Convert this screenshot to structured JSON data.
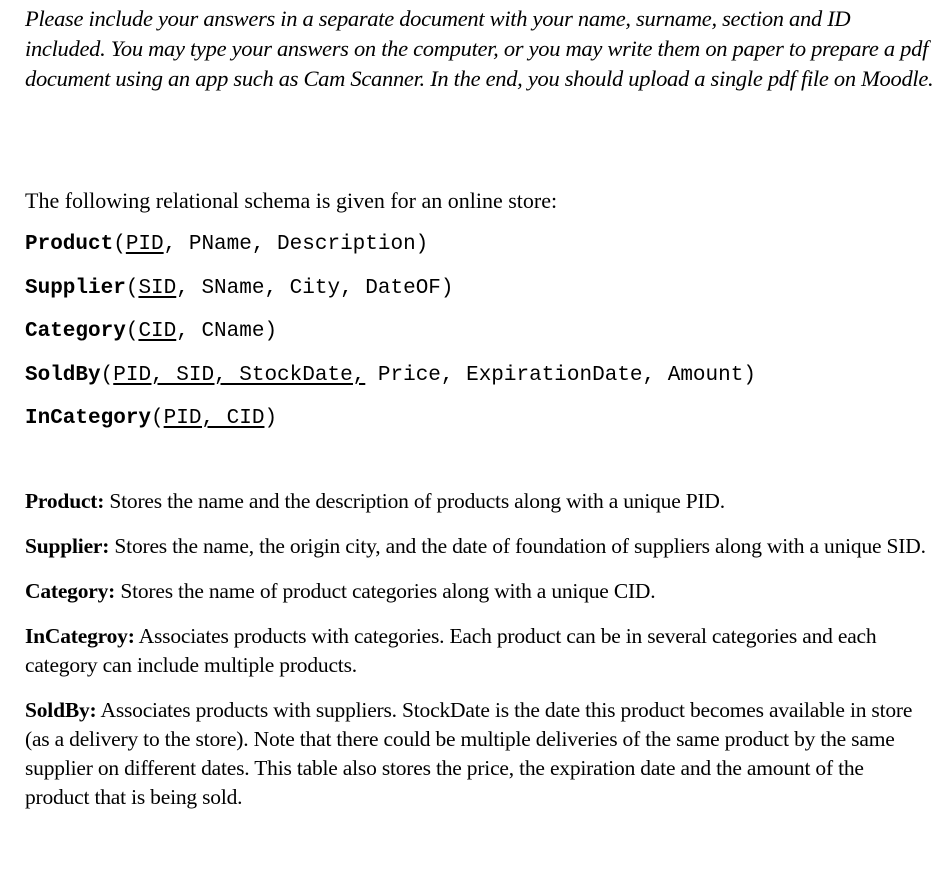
{
  "instructions": "Please include your answers in a separate document with your name, surname, section and ID included. You may type your answers on the computer, or you may write them on paper to prepare a pdf document using an app such as Cam Scanner. In the end, you should upload a single pdf file on Moodle.",
  "intro": "The following relational schema is given for an online store:",
  "schema": [
    {
      "table": "Product",
      "key_text": "PID",
      "rest_text": ", PName, Description)"
    },
    {
      "table": "Supplier",
      "key_text": "SID",
      "rest_text": ", SName, City, DateOF)"
    },
    {
      "table": "Category",
      "key_text": "CID",
      "rest_text": ", CName)"
    },
    {
      "table": "SoldBy",
      "key_text": "PID, SID, StockDate,",
      "rest_text": " Price, ExpirationDate, Amount)"
    },
    {
      "table": "InCategory",
      "key_text": "PID, CID",
      "rest_text": ")"
    }
  ],
  "descriptions": [
    {
      "name": "Product:",
      "text": " Stores the name and the description of products along with a unique PID."
    },
    {
      "name": "Supplier:",
      "text": " Stores the name, the origin city, and the date of foundation of suppliers along with a unique SID."
    },
    {
      "name": "Category:",
      "text": " Stores the name of product categories along with a unique CID."
    },
    {
      "name": "InCategroy:",
      "text": " Associates products with categories. Each product can be in several categories and each category can include multiple products."
    },
    {
      "name": "SoldBy:",
      "text": " Associates products with suppliers. StockDate is the date this product becomes available in store (as a delivery to the store). Note that there could be multiple deliveries of the same product by the same supplier on different dates. This table also stores the price, the expiration date and the amount of the product that is being sold."
    }
  ]
}
